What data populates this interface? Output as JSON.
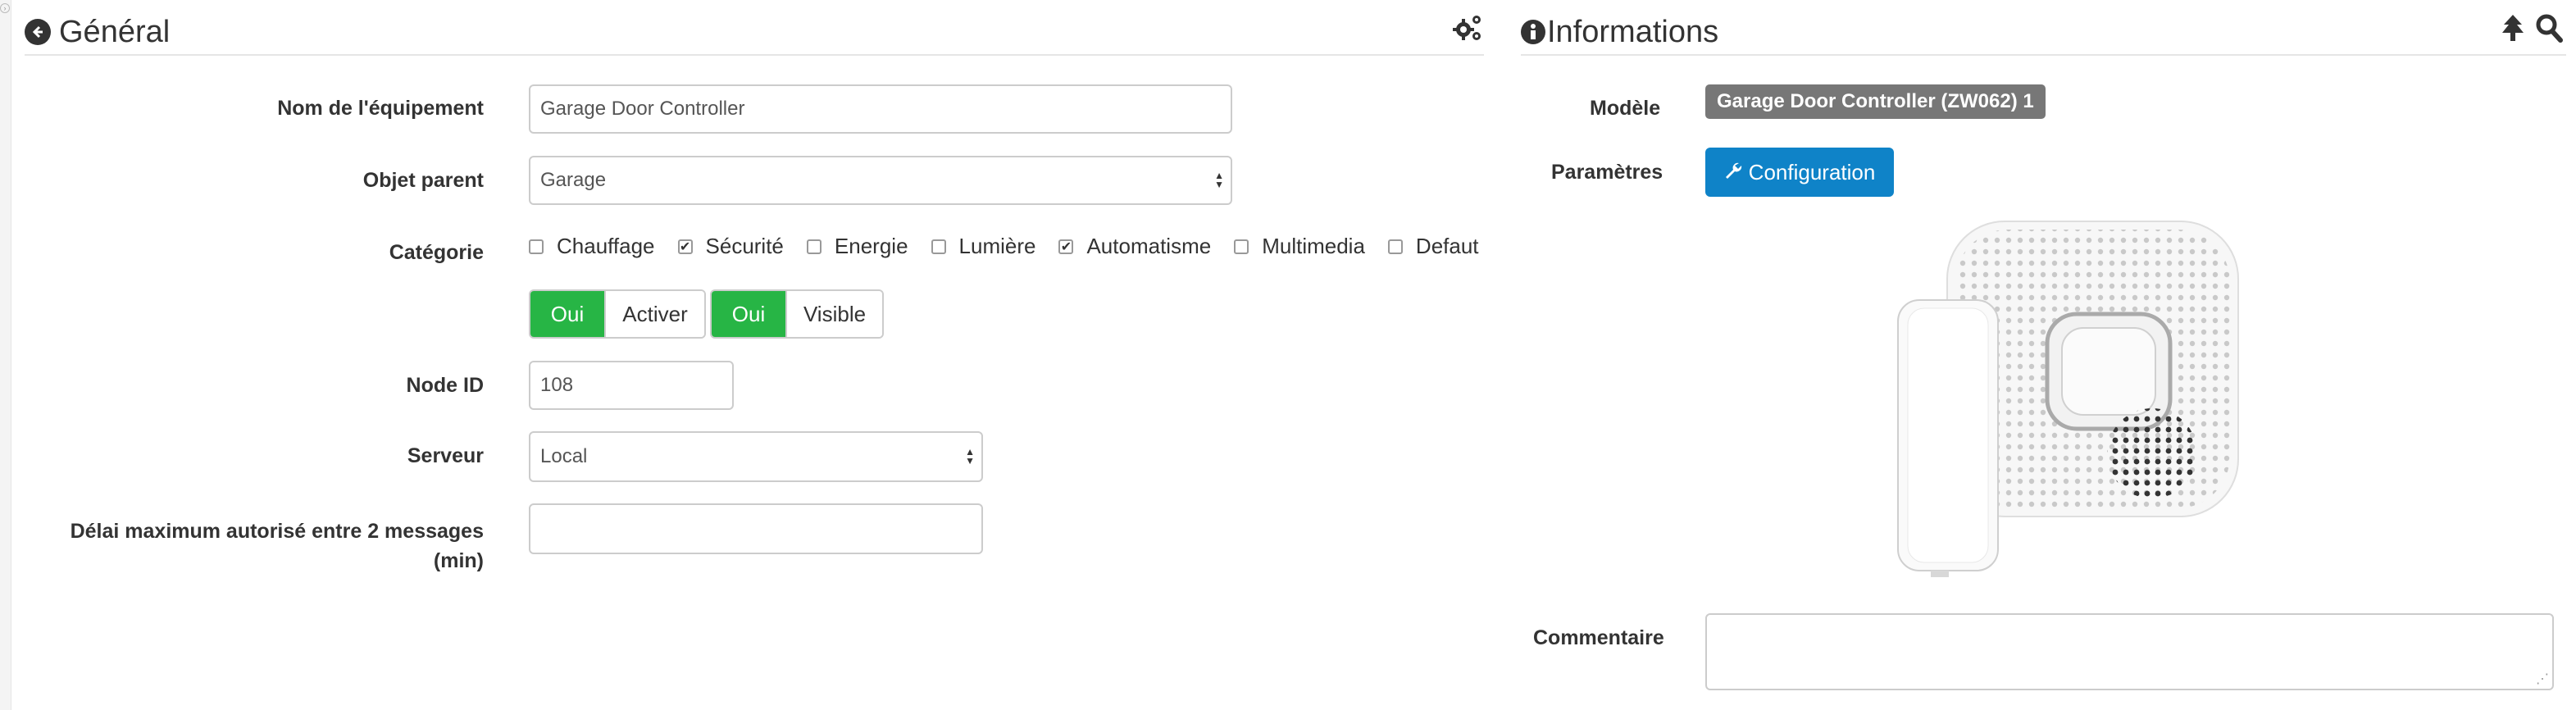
{
  "general": {
    "title": "Général",
    "fields": {
      "name_label": "Nom de l'équipement",
      "name_value": "Garage Door Controller",
      "parent_label": "Objet parent",
      "parent_value": "Garage",
      "category_label": "Catégorie",
      "categories": [
        {
          "label": "Chauffage",
          "checked": false
        },
        {
          "label": "Sécurité",
          "checked": true
        },
        {
          "label": "Energie",
          "checked": false
        },
        {
          "label": "Lumière",
          "checked": false
        },
        {
          "label": "Automatisme",
          "checked": true
        },
        {
          "label": "Multimedia",
          "checked": false
        },
        {
          "label": "Defaut",
          "checked": false
        }
      ],
      "enable_toggle": {
        "on": "Oui",
        "label": "Activer"
      },
      "visible_toggle": {
        "on": "Oui",
        "label": "Visible"
      },
      "node_label": "Node ID",
      "node_value": "108",
      "server_label": "Serveur",
      "server_value": "Local",
      "delay_label_line1": "Délai maximum autorisé entre 2 messages",
      "delay_label_line2": "(min)",
      "delay_value": ""
    }
  },
  "informations": {
    "title": "Informations",
    "model_label": "Modèle",
    "model_value": "Garage Door Controller (ZW062) 1",
    "params_label": "Paramètres",
    "config_button": "Configuration",
    "comment_label": "Commentaire",
    "comment_value": ""
  },
  "icons": {
    "back": "circle-arrow-left-icon",
    "gears": "gears-icon",
    "info": "info-circle-icon",
    "tree": "tree-icon",
    "search": "search-icon",
    "wrench": "wrench-icon"
  },
  "colors": {
    "green": "#27b545",
    "blue": "#0f83c8",
    "badge": "#777777"
  }
}
